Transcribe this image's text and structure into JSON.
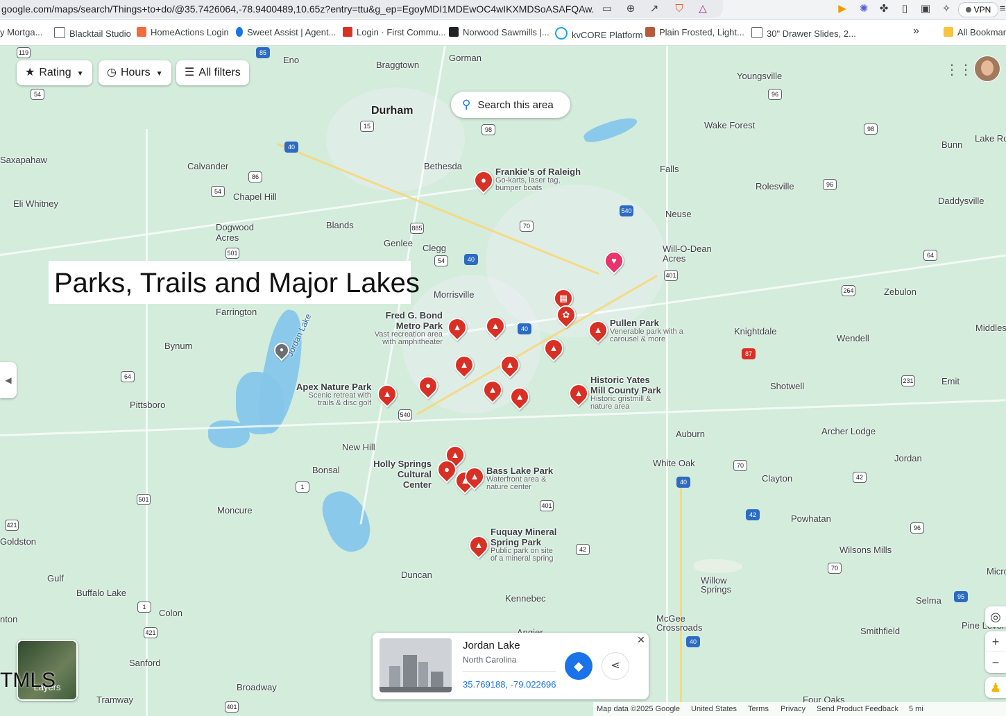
{
  "browser": {
    "url": "google.com/maps/search/Things+to+do/@35.7426064,-78.9400489,10.65z?entry=ttu&g_ep=EgoyMDI1MDEwOC4wIKXMDSoASAFQAw...",
    "vpn_label": "VPN",
    "bookmarks": [
      "y Mortga...",
      "Blacktail Studio",
      "HomeActions Login",
      "Sweet Assist | Agent...",
      "Login · First Commu...",
      "Norwood Sawmills |...",
      "kvCORE Platform",
      "Plain Frosted, Light...",
      "30\" Drawer Slides, 2...",
      "All Bookmarks"
    ],
    "bookmark_overflow": "»"
  },
  "filters": {
    "rating": "Rating",
    "hours": "Hours",
    "all_filters": "All filters"
  },
  "search_area": "Search this area",
  "overlay_title": "Parks, Trails and Major Lakes",
  "overlay_watermark": "TMLS",
  "layers_label": "Layers",
  "towns": {
    "gorman": "Gorman",
    "eno": "Eno",
    "braggtown": "Braggtown",
    "durham": "Durham",
    "youngsville": "Youngsville",
    "wake_forest": "Wake Forest",
    "bunn": "Bunn",
    "lake_ro": "Lake Ro",
    "saxapahaw": "Saxapahaw",
    "calvander": "Calvander",
    "bethesda": "Bethesda",
    "falls": "Falls",
    "rolesville": "Rolesville",
    "daddysville": "Daddysville",
    "eli_whitney": "Eli Whitney",
    "chapel_hill": "Chapel Hill",
    "blands": "Blands",
    "neuse": "Neuse",
    "dogwood_acres": "Dogwood Acres",
    "genlee": "Genlee",
    "clegg": "Clegg",
    "will_o_dean": "Will-O-Dean Acres",
    "zebulon": "Zebulon",
    "morrisville": "Morrisville",
    "farrington": "Farrington",
    "knightdale": "Knightdale",
    "middles": "Middles",
    "wendell": "Wendell",
    "bynum": "Bynum",
    "jordan_lake": "Jordan Lake",
    "shotwell": "Shotwell",
    "emit": "Emit",
    "pittsboro": "Pittsboro",
    "archer_lodge": "Archer Lodge",
    "auburn": "Auburn",
    "new_hill": "New Hill",
    "jordan": "Jordan",
    "bonsal": "Bonsal",
    "white_oak": "White Oak",
    "clayton": "Clayton",
    "moncure": "Moncure",
    "powhatan": "Powhatan",
    "goldston": "Goldston",
    "wilsons_mills": "Wilsons Mills",
    "micro": "Micro",
    "gulf": "Gulf",
    "duncan": "Duncan",
    "willow_springs": "Willow Springs",
    "buffalo_lake": "Buffalo Lake",
    "kennebec": "Kennebec",
    "selma": "Selma",
    "nton": "nton",
    "colon": "Colon",
    "mcgee": "McGee Crossroads",
    "smithfield": "Smithfield",
    "pine_level": "Pine Level",
    "sanford": "Sanford",
    "broadway": "Broadway",
    "angier": "Angier",
    "tramway": "Tramway",
    "four_oaks": "Four Oaks"
  },
  "shields": [
    "119",
    "85",
    "54",
    "40",
    "15",
    "501",
    "98",
    "86",
    "54",
    "40",
    "885",
    "70",
    "540",
    "54",
    "40",
    "401",
    "96",
    "98",
    "96",
    "64",
    "264",
    "40",
    "87",
    "64",
    "540",
    "231",
    "1",
    "501",
    "401",
    "70",
    "42",
    "40",
    "42",
    "421",
    "1",
    "421",
    "401",
    "96",
    "70",
    "95",
    "40",
    "42"
  ],
  "places": {
    "frankies": {
      "name": "Frankie's of Raleigh",
      "desc": "Go-karts, laser tag, bumper boats"
    },
    "fred_bond": {
      "name": "Fred G. Bond Metro Park",
      "desc": "Vast recreation area with amphitheater"
    },
    "pullen": {
      "name": "Pullen Park",
      "desc": "Venerable park with a carousel & more"
    },
    "apex_nature": {
      "name": "Apex Nature Park",
      "desc": "Scenic retreat with trails & disc golf"
    },
    "yates_mill": {
      "name": "Historic Yates Mill County Park",
      "desc": "Historic gristmill & nature area"
    },
    "holly_springs": {
      "name": "Holly Springs Cultural Center",
      "desc": ""
    },
    "bass_lake": {
      "name": "Bass Lake Park",
      "desc": "Waterfront area & nature center"
    },
    "fuquay": {
      "name": "Fuquay Mineral Spring Park",
      "desc": "Public park on site of a mineral spring"
    }
  },
  "card": {
    "name": "Jordan Lake",
    "region": "North Carolina",
    "coords": "35.769188, -79.022696"
  },
  "footer": {
    "map_data": "Map data ©2025 Google",
    "country": "United States",
    "terms": "Terms",
    "privacy": "Privacy",
    "feedback": "Send Product Feedback",
    "scale": "5 mi"
  },
  "colors": {
    "pin_red": "#d93025",
    "pin_pink": "#e8336b",
    "accent_blue": "#1a73e8",
    "map_green": "#d3ecdc",
    "water": "#86c7e9"
  },
  "icons": {
    "pin_tree": "tree-icon",
    "pin_dot": "dot-icon",
    "pin_heart": "heart-icon",
    "directions": "directions-icon",
    "share": "share-icon",
    "close": "close-icon",
    "apps": "apps-grid-icon",
    "locate": "my-location-icon",
    "zoom_in": "plus-icon",
    "zoom_out": "minus-icon",
    "pegman": "pegman-icon"
  }
}
